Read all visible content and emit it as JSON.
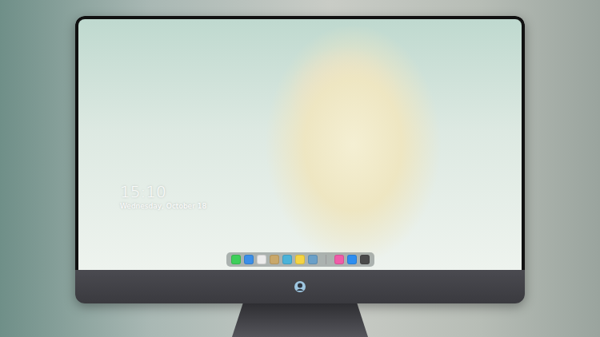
{
  "desktop": {
    "time": "15:10",
    "date": "Wednesday, October 18"
  },
  "dock": {
    "items": [
      {
        "kind": "app",
        "color": "#3ecf5a"
      },
      {
        "kind": "app",
        "color": "#3b8fe8"
      },
      {
        "kind": "app",
        "color": "#ececec"
      },
      {
        "kind": "app",
        "color": "#c9a86a"
      },
      {
        "kind": "app",
        "color": "#4ab3d9"
      },
      {
        "kind": "app",
        "color": "#f5d442"
      },
      {
        "kind": "app",
        "color": "#6aa0c8"
      },
      {
        "kind": "separator",
        "color": "#9a9a9a"
      },
      {
        "kind": "app",
        "color": "#f05ca8"
      },
      {
        "kind": "app",
        "color": "#2d8ef0"
      },
      {
        "kind": "app",
        "color": "#4a4a4a"
      }
    ]
  }
}
